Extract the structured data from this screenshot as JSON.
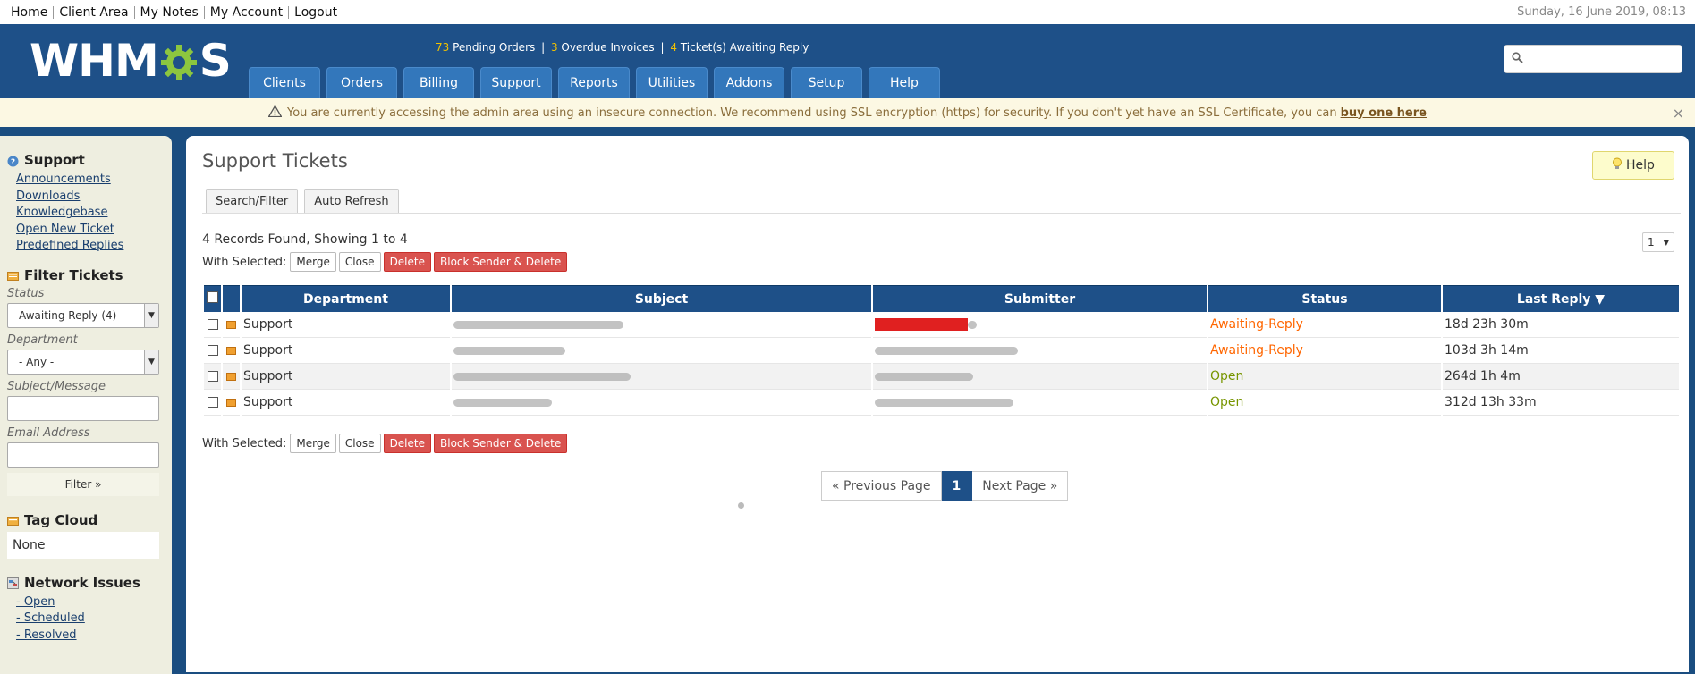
{
  "topbar": {
    "links": [
      "Home",
      "Client Area",
      "My Notes",
      "My Account",
      "Logout"
    ],
    "date": "Sunday, 16 June 2019, 08:13"
  },
  "header": {
    "logo_left": "WHM",
    "logo_right": "S",
    "stats": {
      "pending_num": "73",
      "pending_label": "Pending Orders",
      "overdue_num": "3",
      "overdue_label": "Overdue Invoices",
      "tickets_num": "4",
      "tickets_label": "Ticket(s) Awaiting Reply"
    },
    "nav": [
      "Clients",
      "Orders",
      "Billing",
      "Support",
      "Reports",
      "Utilities",
      "Addons",
      "Setup",
      "Help"
    ],
    "search_placeholder": ""
  },
  "warning": {
    "text": "You are currently accessing the admin area using an insecure connection. We recommend using SSL encryption (https) for security. If you don't yet have an SSL Certificate, you can",
    "link": "buy one here",
    "close": "×"
  },
  "sidebar": {
    "support": {
      "heading": "Support",
      "links": [
        "Announcements",
        "Downloads",
        "Knowledgebase",
        "Open New Ticket",
        "Predefined Replies"
      ]
    },
    "filter": {
      "heading": "Filter Tickets",
      "status_label": "Status",
      "status_value": "Awaiting Reply (4)",
      "department_label": "Department",
      "department_value": "- Any -",
      "subject_label": "Subject/Message",
      "email_label": "Email Address",
      "button": "Filter »"
    },
    "tagcloud": {
      "heading": "Tag Cloud",
      "value": "None"
    },
    "network": {
      "heading": "Network Issues",
      "links": [
        "- Open",
        "- Scheduled",
        "- Resolved"
      ]
    }
  },
  "main": {
    "title": "Support Tickets",
    "help": "Help",
    "tabs": [
      "Search/Filter",
      "Auto Refresh"
    ],
    "records": "4 Records Found, Showing 1 to 4",
    "with_selected": "With Selected:",
    "actions": [
      "Merge",
      "Close",
      "Delete",
      "Block Sender & Delete"
    ],
    "page_select": "1",
    "columns": [
      "Department",
      "Subject",
      "Submitter",
      "Status",
      "Last Reply ▼"
    ],
    "rows": [
      {
        "department": "Support",
        "status": "Awaiting-Reply",
        "last_reply": "18d 23h 30m"
      },
      {
        "department": "Support",
        "status": "Awaiting-Reply",
        "last_reply": "103d 3h 14m"
      },
      {
        "department": "Support",
        "status": "Open",
        "last_reply": "264d 1h 4m"
      },
      {
        "department": "Support",
        "status": "Open",
        "last_reply": "312d 13h 33m"
      }
    ],
    "pagination": {
      "prev": "« Previous Page",
      "current": "1",
      "next": "Next Page »"
    }
  },
  "colors": {
    "header_blue": "#1e5088",
    "nav_tab": "#3377bb",
    "awaiting": "#ff6600",
    "open": "#779500",
    "danger": "#d9534f",
    "stat_number": "#f2c200"
  }
}
